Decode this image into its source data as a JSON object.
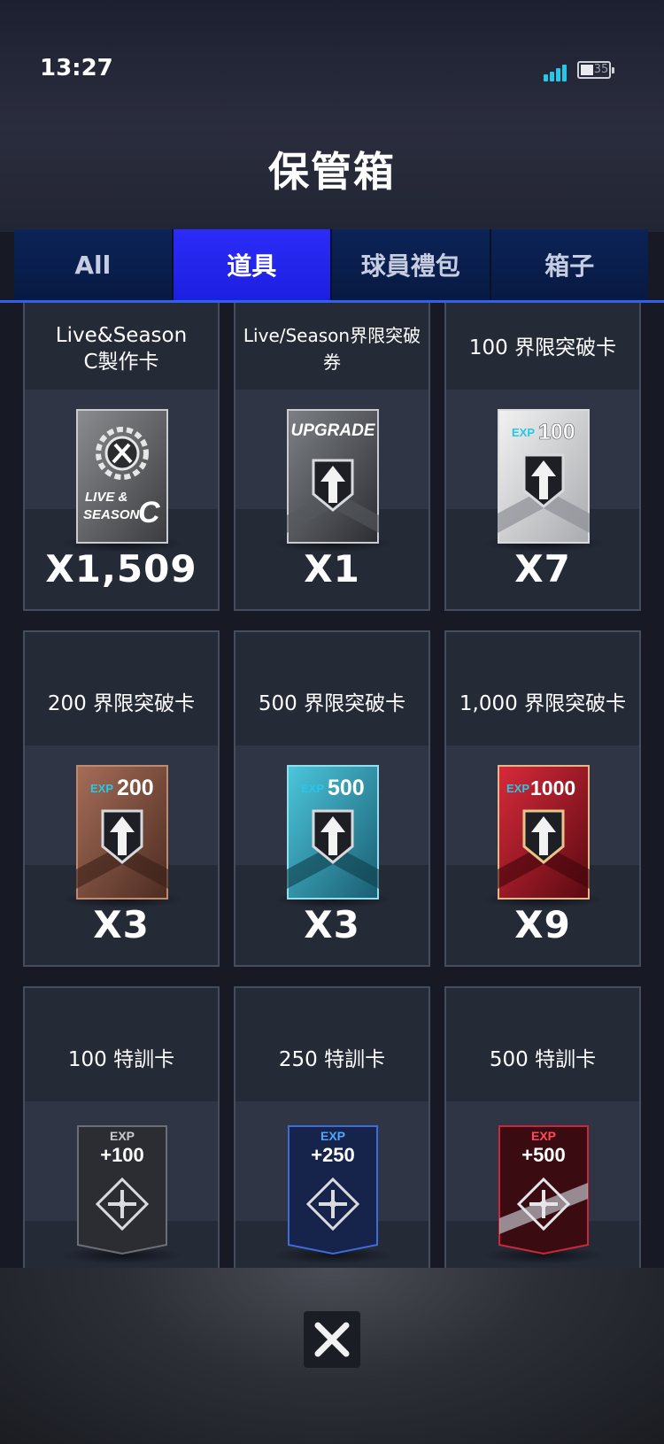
{
  "status_bar": {
    "time": "13:27",
    "battery_level": "35",
    "signal_icon": "signal-bars-icon",
    "battery_icon": "battery-icon"
  },
  "header": {
    "title": "保管箱"
  },
  "tabs": [
    {
      "label": "All",
      "active": false
    },
    {
      "label": "道具",
      "active": true
    },
    {
      "label": "球員禮包",
      "active": false
    },
    {
      "label": "箱子",
      "active": false
    }
  ],
  "items": [
    {
      "name_line1": "Live&Season",
      "name_line2": "C製作卡",
      "count": "X1,509",
      "art": {
        "type": "crafting",
        "text1": "LIVE &",
        "text2": "SEASON",
        "grade": "C"
      }
    },
    {
      "name_line1": "Live/Season界限突破",
      "name_line2": "券",
      "count": "X1",
      "art": {
        "type": "upgrade",
        "label": "UPGRADE"
      }
    },
    {
      "name_line1": "100 界限突破卡",
      "name_line2": "",
      "count": "X7",
      "art": {
        "type": "exp",
        "exp_label": "EXP",
        "value": "100"
      }
    },
    {
      "name_line1": "200 界限突破卡",
      "name_line2": "",
      "count": "X3",
      "art": {
        "type": "exp",
        "exp_label": "EXP",
        "value": "200"
      }
    },
    {
      "name_line1": "500 界限突破卡",
      "name_line2": "",
      "count": "X3",
      "art": {
        "type": "exp",
        "exp_label": "EXP",
        "value": "500"
      }
    },
    {
      "name_line1": "1,000 界限突破卡",
      "name_line2": "",
      "count": "X9",
      "art": {
        "type": "exp",
        "exp_label": "EXP",
        "value": "1000"
      }
    },
    {
      "name_line1": "100 特訓卡",
      "name_line2": "",
      "count": "",
      "art": {
        "type": "training",
        "exp_label": "EXP",
        "value": "+100"
      }
    },
    {
      "name_line1": "250 特訓卡",
      "name_line2": "",
      "count": "",
      "art": {
        "type": "training",
        "exp_label": "EXP",
        "value": "+250"
      }
    },
    {
      "name_line1": "500 特訓卡",
      "name_line2": "",
      "count": "",
      "art": {
        "type": "training",
        "exp_label": "EXP",
        "value": "+500"
      }
    }
  ],
  "close_button": {
    "icon": "close-icon"
  },
  "colors": {
    "active_tab": "#2b2cf8",
    "tab_bg": "#0b2357",
    "exp_cyan": "#27c7e8"
  }
}
